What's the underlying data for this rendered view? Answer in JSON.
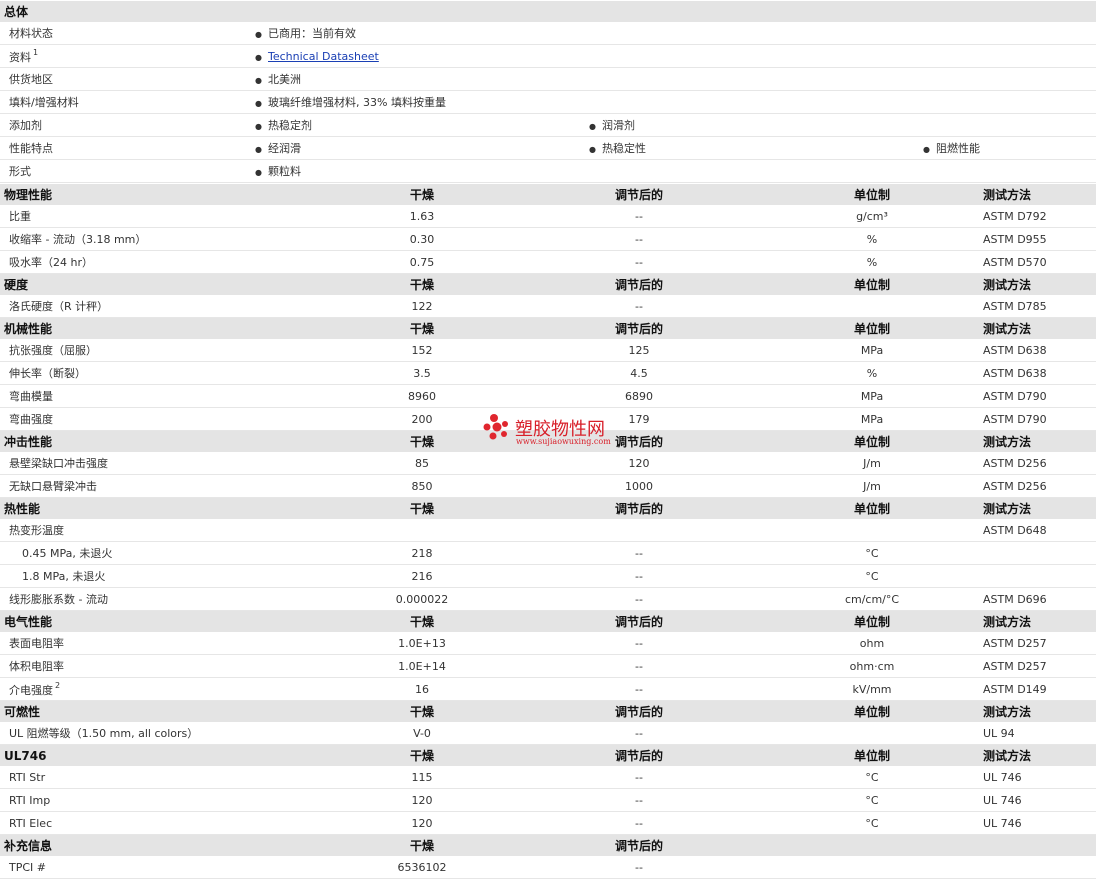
{
  "general": {
    "title": "总体",
    "rows": [
      {
        "label": "材料状态",
        "sup": "",
        "cols": [
          "已商用：当前有效",
          "",
          ""
        ]
      },
      {
        "label": "资料",
        "sup": "1",
        "cols": [
          "Technical Datasheet",
          "",
          ""
        ],
        "link": true
      },
      {
        "label": "供货地区",
        "sup": "",
        "cols": [
          "北美洲",
          "",
          ""
        ]
      },
      {
        "label": "填料/增强材料",
        "sup": "",
        "cols": [
          "玻璃纤维增强材料, 33% 填料按重量",
          "",
          ""
        ]
      },
      {
        "label": "添加剂",
        "sup": "",
        "cols": [
          "热稳定剂",
          "润滑剂",
          ""
        ]
      },
      {
        "label": "性能特点",
        "sup": "",
        "cols": [
          "经润滑",
          "热稳定性",
          "阻燃性能"
        ]
      },
      {
        "label": "形式",
        "sup": "",
        "cols": [
          "颗粒料",
          "",
          ""
        ]
      }
    ]
  },
  "headers": {
    "dry": "干燥",
    "conditioned": "调节后的",
    "unit": "单位制",
    "method": "测试方法"
  },
  "sections": [
    {
      "title": "物理性能",
      "rows": [
        {
          "label": "比重",
          "dry": "1.63",
          "cond": "--",
          "unit": "g/cm³",
          "method": "ASTM D792"
        },
        {
          "label": "收缩率  - 流动（3.18 mm）",
          "dry": "0.30",
          "cond": "--",
          "unit": "%",
          "method": "ASTM D955"
        },
        {
          "label": "吸水率（24 hr）",
          "dry": "0.75",
          "cond": "--",
          "unit": "%",
          "method": "ASTM D570"
        }
      ]
    },
    {
      "title": "硬度",
      "rows": [
        {
          "label": "洛氏硬度（R 计秤）",
          "dry": "122",
          "cond": "--",
          "unit": "",
          "method": "ASTM D785"
        }
      ]
    },
    {
      "title": "机械性能",
      "rows": [
        {
          "label": "抗张强度（屈服）",
          "dry": "152",
          "cond": "125",
          "unit": "MPa",
          "method": "ASTM D638"
        },
        {
          "label": "伸长率（断裂）",
          "dry": "3.5",
          "cond": "4.5",
          "unit": "%",
          "method": "ASTM D638"
        },
        {
          "label": "弯曲模量",
          "dry": "8960",
          "cond": "6890",
          "unit": "MPa",
          "method": "ASTM D790"
        },
        {
          "label": "弯曲强度",
          "dry": "200",
          "cond": "179",
          "unit": "MPa",
          "method": "ASTM D790"
        }
      ]
    },
    {
      "title": "冲击性能",
      "rows": [
        {
          "label": "悬壁梁缺口冲击强度",
          "dry": "85",
          "cond": "120",
          "unit": "J/m",
          "method": "ASTM D256"
        },
        {
          "label": "无缺口悬臂梁冲击",
          "dry": "850",
          "cond": "1000",
          "unit": "J/m",
          "method": "ASTM D256"
        }
      ]
    },
    {
      "title": "热性能",
      "rows": [
        {
          "label": "热变形温度",
          "dry": "",
          "cond": "",
          "unit": "",
          "method": "ASTM D648"
        },
        {
          "label": "0.45 MPa, 未退火",
          "dry": "218",
          "cond": "--",
          "unit": "°C",
          "method": "",
          "indent": true
        },
        {
          "label": "1.8 MPa, 未退火",
          "dry": "216",
          "cond": "--",
          "unit": "°C",
          "method": "",
          "indent": true
        },
        {
          "label": "线形膨胀系数  - 流动",
          "dry": "0.000022",
          "cond": "--",
          "unit": "cm/cm/°C",
          "method": "ASTM D696"
        }
      ]
    },
    {
      "title": "电气性能",
      "rows": [
        {
          "label": "表面电阻率",
          "dry": "1.0E+13",
          "cond": "--",
          "unit": "ohm",
          "method": "ASTM D257"
        },
        {
          "label": "体积电阻率",
          "dry": "1.0E+14",
          "cond": "--",
          "unit": "ohm·cm",
          "method": "ASTM D257"
        },
        {
          "label": "介电强度",
          "sup": "2",
          "dry": "16",
          "cond": "--",
          "unit": "kV/mm",
          "method": "ASTM D149"
        }
      ]
    },
    {
      "title": "可燃性",
      "rows": [
        {
          "label": "UL 阻燃等级（1.50 mm, all colors）",
          "dry": "V-0",
          "cond": "--",
          "unit": "",
          "method": "UL 94"
        }
      ]
    },
    {
      "title": "UL746",
      "rows": [
        {
          "label": "RTI Str",
          "dry": "115",
          "cond": "--",
          "unit": "°C",
          "method": "UL 746"
        },
        {
          "label": "RTI Imp",
          "dry": "120",
          "cond": "--",
          "unit": "°C",
          "method": "UL 746"
        },
        {
          "label": "RTI Elec",
          "dry": "120",
          "cond": "--",
          "unit": "°C",
          "method": "UL 746"
        }
      ]
    },
    {
      "title": "补充信息",
      "short_header": true,
      "rows": [
        {
          "label": "TPCI #",
          "dry": "6536102",
          "cond": "--",
          "unit": "",
          "method": ""
        }
      ]
    }
  ],
  "watermark": {
    "name": "塑胶物性网",
    "url": "www.sujiaowuxing.com"
  }
}
